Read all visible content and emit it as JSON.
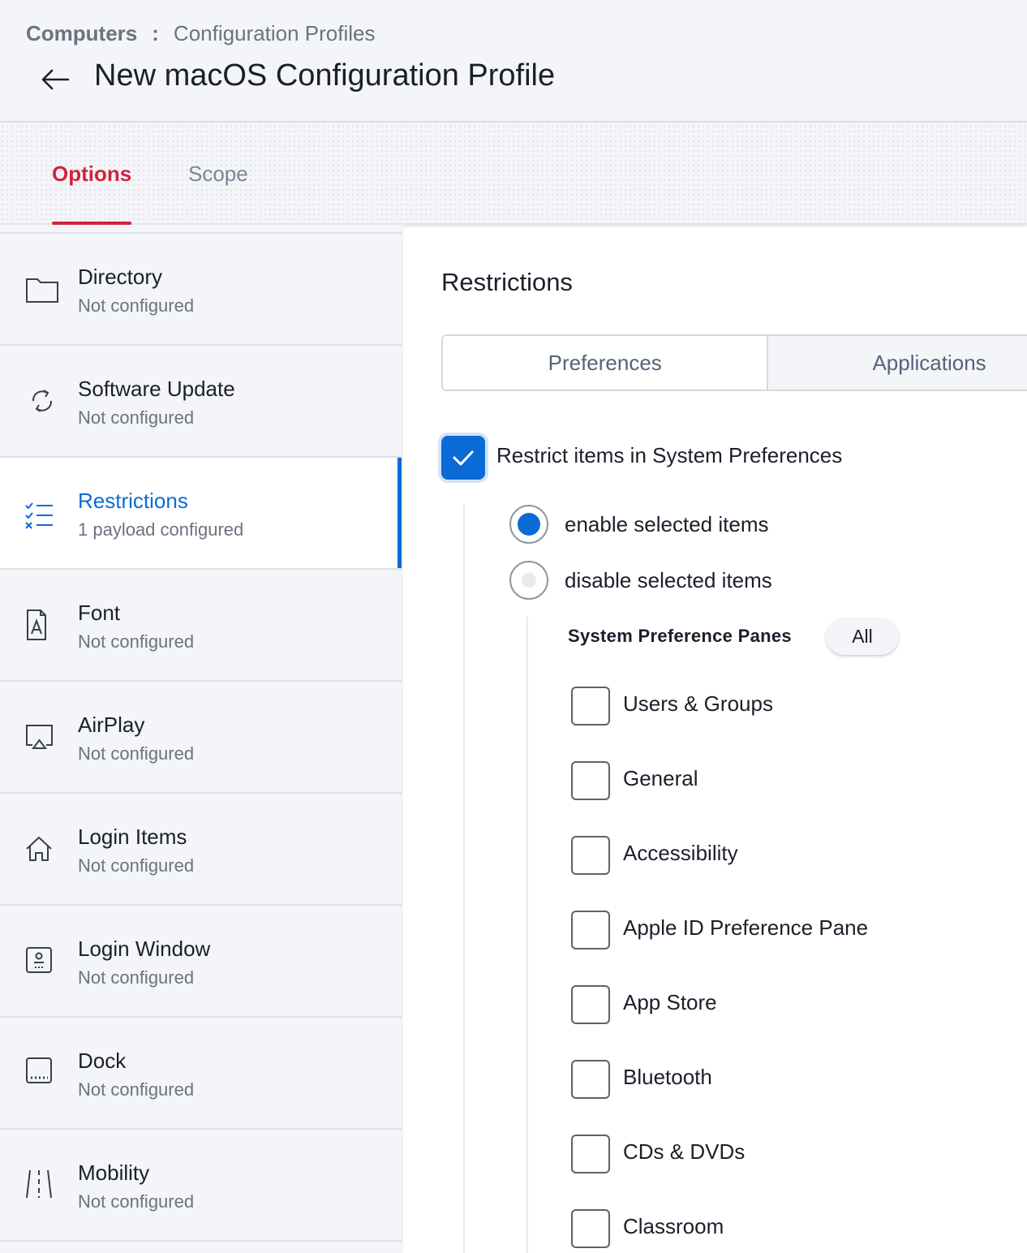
{
  "breadcrumb": {
    "root": "Computers",
    "separator": ":",
    "current": "Configuration Profiles"
  },
  "page": {
    "title": "New macOS Configuration Profile"
  },
  "tabs": [
    {
      "label": "Options",
      "active": true
    },
    {
      "label": "Scope",
      "active": false
    }
  ],
  "sidebar": {
    "items": [
      {
        "title": "Directory",
        "subtitle": "Not configured",
        "icon": "folder-icon"
      },
      {
        "title": "Software Update",
        "subtitle": "Not configured",
        "icon": "refresh-icon"
      },
      {
        "title": "Restrictions",
        "subtitle": "1 payload configured",
        "icon": "checklist-icon",
        "active": true
      },
      {
        "title": "Font",
        "subtitle": "Not configured",
        "icon": "font-file-icon"
      },
      {
        "title": "AirPlay",
        "subtitle": "Not configured",
        "icon": "airplay-icon"
      },
      {
        "title": "Login Items",
        "subtitle": "Not configured",
        "icon": "home-icon"
      },
      {
        "title": "Login Window",
        "subtitle": "Not configured",
        "icon": "login-window-icon"
      },
      {
        "title": "Dock",
        "subtitle": "Not configured",
        "icon": "dock-icon"
      },
      {
        "title": "Mobility",
        "subtitle": "Not configured",
        "icon": "mobility-icon"
      }
    ]
  },
  "main": {
    "section_title": "Restrictions",
    "segments": [
      {
        "label": "Preferences",
        "selected": true
      },
      {
        "label": "Applications",
        "selected": false
      }
    ],
    "restrict_checkbox": {
      "label": "Restrict items in System Preferences",
      "checked": true
    },
    "mode_options": [
      {
        "label": "enable selected items",
        "selected": true
      },
      {
        "label": "disable selected items",
        "selected": false
      }
    ],
    "panes_label": "System Preference Panes",
    "all_button": "All",
    "panes": [
      {
        "label": "Users & Groups",
        "checked": false
      },
      {
        "label": "General",
        "checked": false
      },
      {
        "label": "Accessibility",
        "checked": false
      },
      {
        "label": "Apple ID Preference Pane",
        "checked": false
      },
      {
        "label": "App Store",
        "checked": false
      },
      {
        "label": "Bluetooth",
        "checked": false
      },
      {
        "label": "CDs & DVDs",
        "checked": false
      },
      {
        "label": "Classroom",
        "checked": false
      }
    ]
  },
  "colors": {
    "accent": "#0b6bd6",
    "tab_active": "#d4213d",
    "muted": "#6b7280"
  }
}
